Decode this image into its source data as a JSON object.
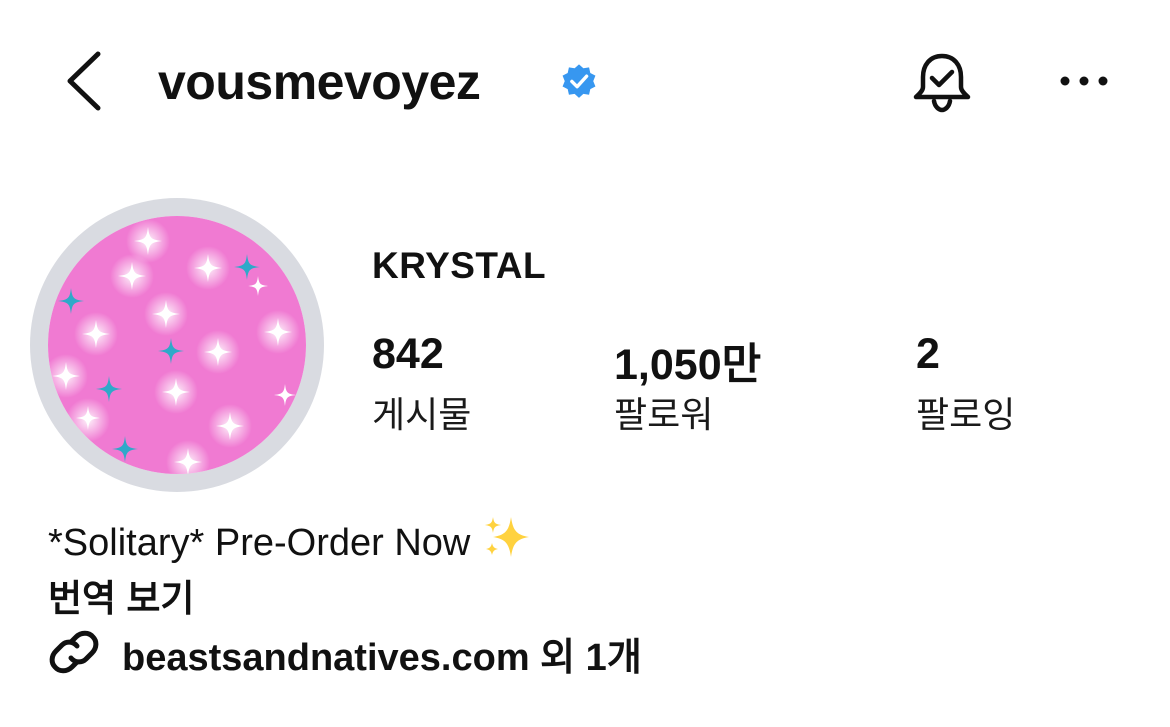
{
  "header": {
    "username": "vousmevoyez",
    "icons": {
      "back": "chevron-left-icon",
      "verified": "verified-badge-icon",
      "notifications": "bell-check-icon",
      "more": "more-horizontal-icon"
    }
  },
  "profile": {
    "display_name": "KRYSTAL",
    "avatar": "pink-sparkle-avatar",
    "stats": [
      {
        "value": "842",
        "label": "게시물"
      },
      {
        "value": "1,050만",
        "label": "팔로워"
      },
      {
        "value": "2",
        "label": "팔로잉"
      }
    ]
  },
  "bio": {
    "text": "*Solitary* Pre-Order Now",
    "emoji": "sparkles-icon",
    "translate_label": "번역 보기",
    "link_text": "beastsandnatives.com 외 1개",
    "link_icon": "link-icon"
  },
  "colors": {
    "verified_blue": "#3797f0",
    "avatar_pink": "#f07ad2",
    "ring_grey": "#d9dbe1",
    "text": "#111111"
  }
}
